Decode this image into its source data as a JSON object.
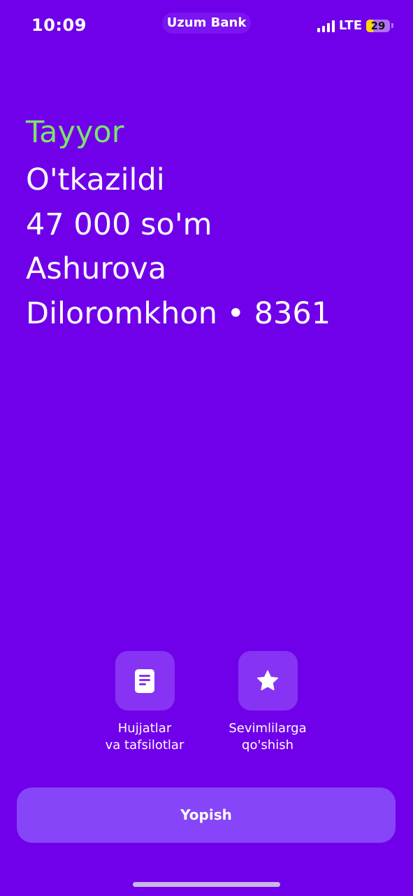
{
  "status_bar": {
    "time": "10:09",
    "app_name": "Uzum Bank",
    "network": "LTE",
    "battery": "29",
    "battery_level_percent": 29
  },
  "result": {
    "status": "Tayyor",
    "lines": [
      "O'tkazildi",
      "47 000 so'm",
      "Ashurova",
      "Diloromkhon • 8361"
    ]
  },
  "actions": [
    {
      "icon": "document-icon",
      "label_line1": "Hujjatlar",
      "label_line2": "va tafsilotlar"
    },
    {
      "icon": "star-icon",
      "label_line1": "Sevimlilarga",
      "label_line2": "qo'shish"
    }
  ],
  "close_button": {
    "label": "Yopish"
  },
  "colors": {
    "background": "#7000EA",
    "success_text": "#7CE36B",
    "tile": "#8733F4",
    "button": "#8645F8",
    "battery_fill": "#FFD60A"
  }
}
